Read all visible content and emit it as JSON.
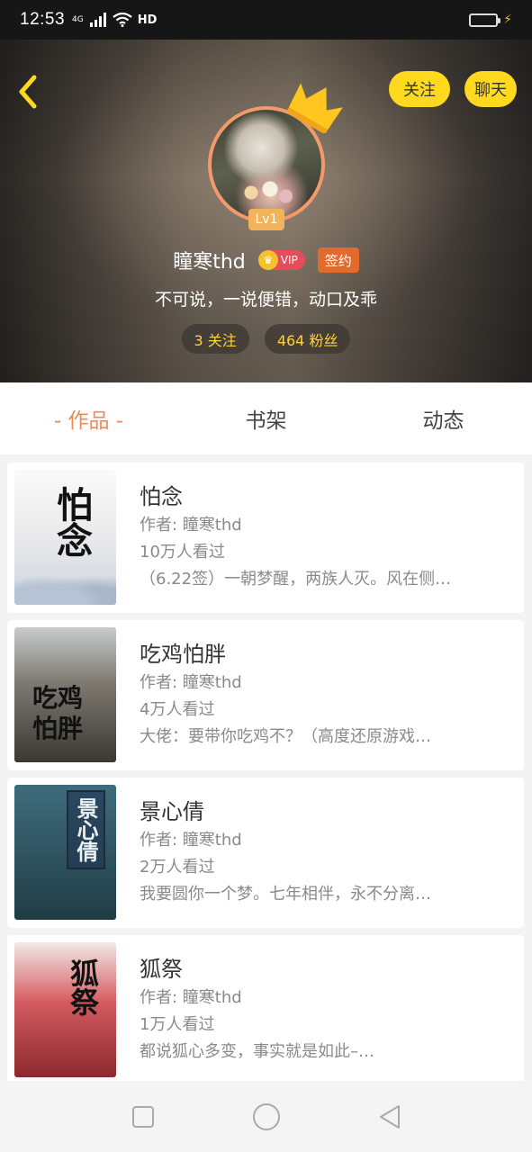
{
  "status_bar": {
    "time": "12:53",
    "network": "4G",
    "hd": "HD"
  },
  "header": {
    "follow_label": "关注",
    "chat_label": "聊天",
    "level": "Lv1",
    "username": "瞳寒thd",
    "vip_label": "VIP",
    "sign_label": "签约",
    "bio": "不可说，一说便错，动口及乖",
    "following": "3 关注",
    "fans": "464 粉丝"
  },
  "tabs": [
    {
      "label": "- 作品 -"
    },
    {
      "label": "书架"
    },
    {
      "label": "动态"
    }
  ],
  "books": [
    {
      "cover_text": "怕念",
      "title": "怕念",
      "author": "作者: 瞳寒thd",
      "views": "10万人看过",
      "desc": "（6.22签）一朝梦醒，两族人灭。风在侧…"
    },
    {
      "cover_text": "吃鸡怕胖",
      "title": "吃鸡怕胖",
      "author": "作者: 瞳寒thd",
      "views": "4万人看过",
      "desc": "大佬：要带你吃鸡不？（高度还原游戏…"
    },
    {
      "cover_text": "景心倩",
      "title": "景心倩",
      "author": "作者: 瞳寒thd",
      "views": "2万人看过",
      "desc": "我要圆你一个梦。七年相伴，永不分离…"
    },
    {
      "cover_text": "狐祭",
      "title": "狐祭",
      "author": "作者: 瞳寒thd",
      "views": "1万人看过",
      "desc": "都说狐心多变，事实就是如此–…"
    }
  ],
  "colors": {
    "accent": "#ffd91e",
    "active_tab": "#ef8a55",
    "avatar_ring": "#f39a6b",
    "sign_badge": "#e26a2c"
  }
}
